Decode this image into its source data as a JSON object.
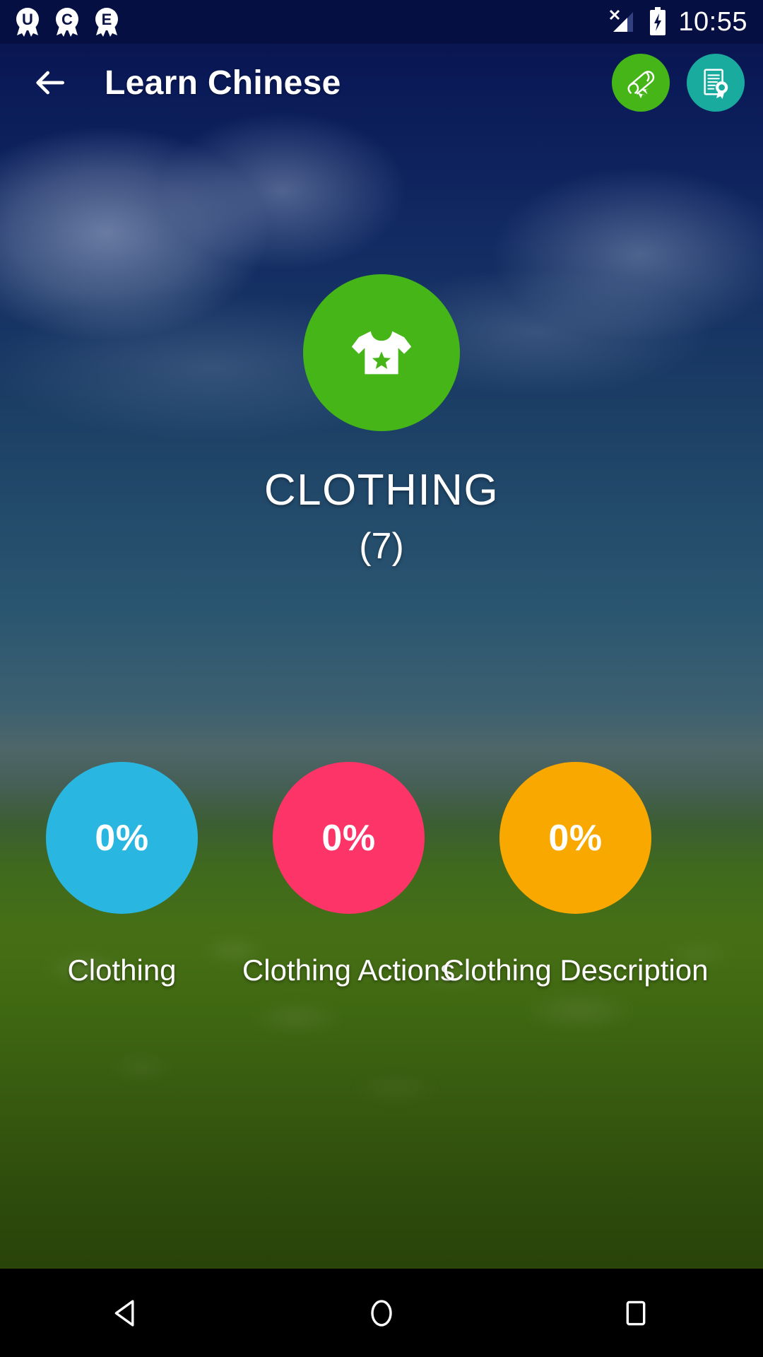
{
  "status_bar": {
    "notifications": [
      {
        "icon": "badge-award-icon",
        "letter": "U"
      },
      {
        "icon": "badge-award-icon",
        "letter": "C"
      },
      {
        "icon": "badge-award-icon",
        "letter": "E"
      }
    ],
    "signal_icon": "signal-no-sim-icon",
    "battery_icon": "battery-charging-icon",
    "time": "10:55"
  },
  "app_bar": {
    "back_icon": "back-arrow-icon",
    "title": "Learn Chinese",
    "actions": [
      {
        "icon": "diploma-scroll-icon",
        "color": "#45b517"
      },
      {
        "icon": "certificate-award-icon",
        "color": "#19ab9e"
      }
    ]
  },
  "category": {
    "icon": "tshirt-icon",
    "color": "#45b517",
    "name": "CLOTHING",
    "count": "(7)"
  },
  "lessons": [
    {
      "label": "Clothing",
      "percent": "0%",
      "color": "#29b6e0"
    },
    {
      "label": "Clothing Actions",
      "percent": "0%",
      "color": "#fc3468"
    },
    {
      "label": "Clothing Description",
      "percent": "0%",
      "color": "#f9a800"
    }
  ],
  "nav_bar": {
    "back": "nav-back-icon",
    "home": "nav-home-icon",
    "recents": "nav-recents-icon"
  }
}
